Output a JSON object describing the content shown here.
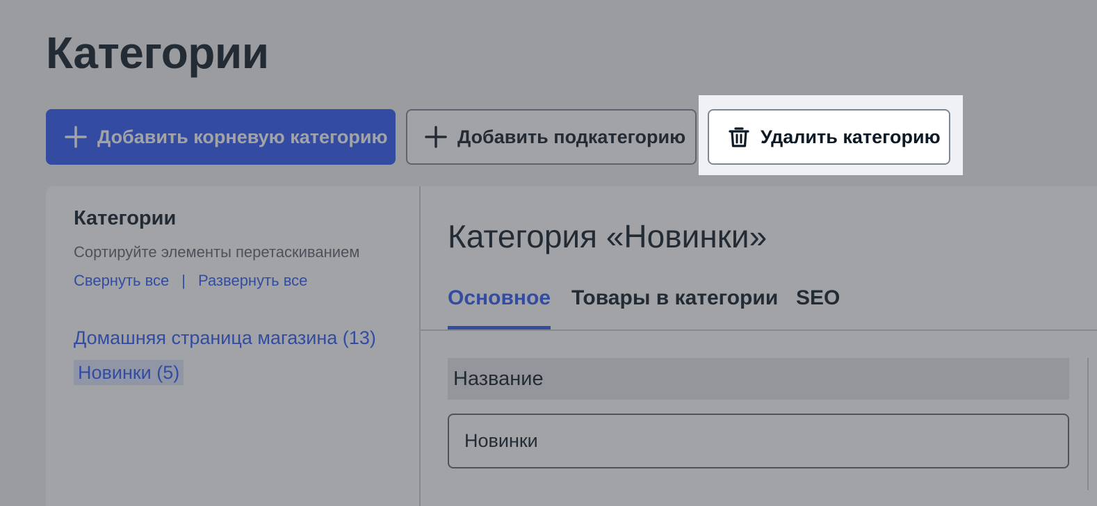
{
  "page": {
    "title": "Категории"
  },
  "toolbar": {
    "add_root_label": "Добавить корневую категорию",
    "add_sub_label": "Добавить подкатегорию",
    "delete_label": "Удалить категорию",
    "add_root_icon": "plus-icon",
    "add_sub_icon": "plus-icon",
    "delete_icon": "trash-icon"
  },
  "tree": {
    "title": "Категории",
    "hint": "Сортируйте элементы перетаскиванием",
    "collapse_all": "Свернуть все",
    "separator": "|",
    "expand_all": "Развернуть все",
    "items": [
      {
        "label": "Домашняя страница магазина (13)",
        "selected": false
      },
      {
        "label": "Новинки (5)",
        "selected": true
      }
    ]
  },
  "detail": {
    "title": "Категория «Новинки»",
    "tabs": [
      {
        "label": "Основное",
        "active": true
      },
      {
        "label": "Товары в категории",
        "active": false
      },
      {
        "label": "SEO",
        "active": false
      }
    ],
    "name_field": {
      "label": "Название",
      "value": "Новинки"
    }
  },
  "colors": {
    "primary": "#2b59f6",
    "text": "#0d1a26",
    "overlay": "rgba(60, 63, 68, 0.48)"
  }
}
